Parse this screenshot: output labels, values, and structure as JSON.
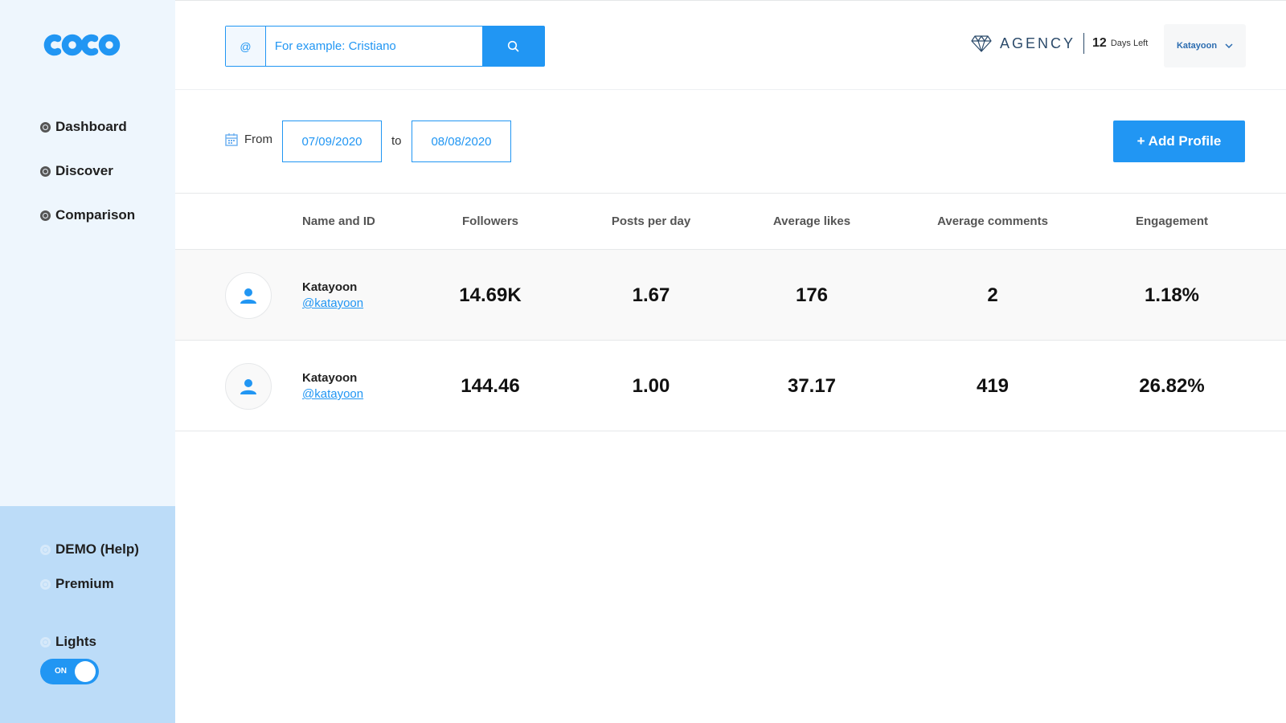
{
  "brand": {
    "logo_text": "COCO",
    "accent": "#2196f3"
  },
  "sidebar": {
    "items": [
      {
        "label": "Dashboard",
        "icon": "globe-icon"
      },
      {
        "label": "Discover",
        "icon": "globe-icon"
      },
      {
        "label": "Comparison",
        "icon": "globe-icon"
      }
    ],
    "bottom_items": [
      {
        "label": "DEMO (Help)",
        "icon": "globe-icon"
      },
      {
        "label": "Premium",
        "icon": "globe-icon"
      }
    ],
    "lights": {
      "label": "Lights",
      "toggle_state": "ON"
    }
  },
  "header": {
    "search": {
      "prefix": "@",
      "placeholder": "For example: Cristiano",
      "icon": "search-icon"
    },
    "plan": {
      "icon": "diamond-icon",
      "name": "AGENCY",
      "days_number": "12",
      "days_label": "Days Left"
    },
    "user": {
      "name": "Katayoon",
      "icon": "chevron-down-icon"
    }
  },
  "filters": {
    "from_label": "From",
    "from_date": "07/09/2020",
    "to_label": "to",
    "to_date": "08/08/2020",
    "add_profile_label": "+ Add Profile"
  },
  "table": {
    "columns": [
      "Name and ID",
      "Followers",
      "Posts per day",
      "Average likes",
      "Average comments",
      "Engagement"
    ],
    "rows": [
      {
        "name": "Katayoon",
        "handle": "@katayoon",
        "followers": "14.69K",
        "posts_per_day": "1.67",
        "avg_likes": "176",
        "avg_comments": "2",
        "engagement": "1.18%"
      },
      {
        "name": "Katayoon",
        "handle": "@katayoon",
        "followers": "144.46",
        "posts_per_day": "1.00",
        "avg_likes": "37.17",
        "avg_comments": "419",
        "engagement": "26.82%"
      }
    ]
  }
}
